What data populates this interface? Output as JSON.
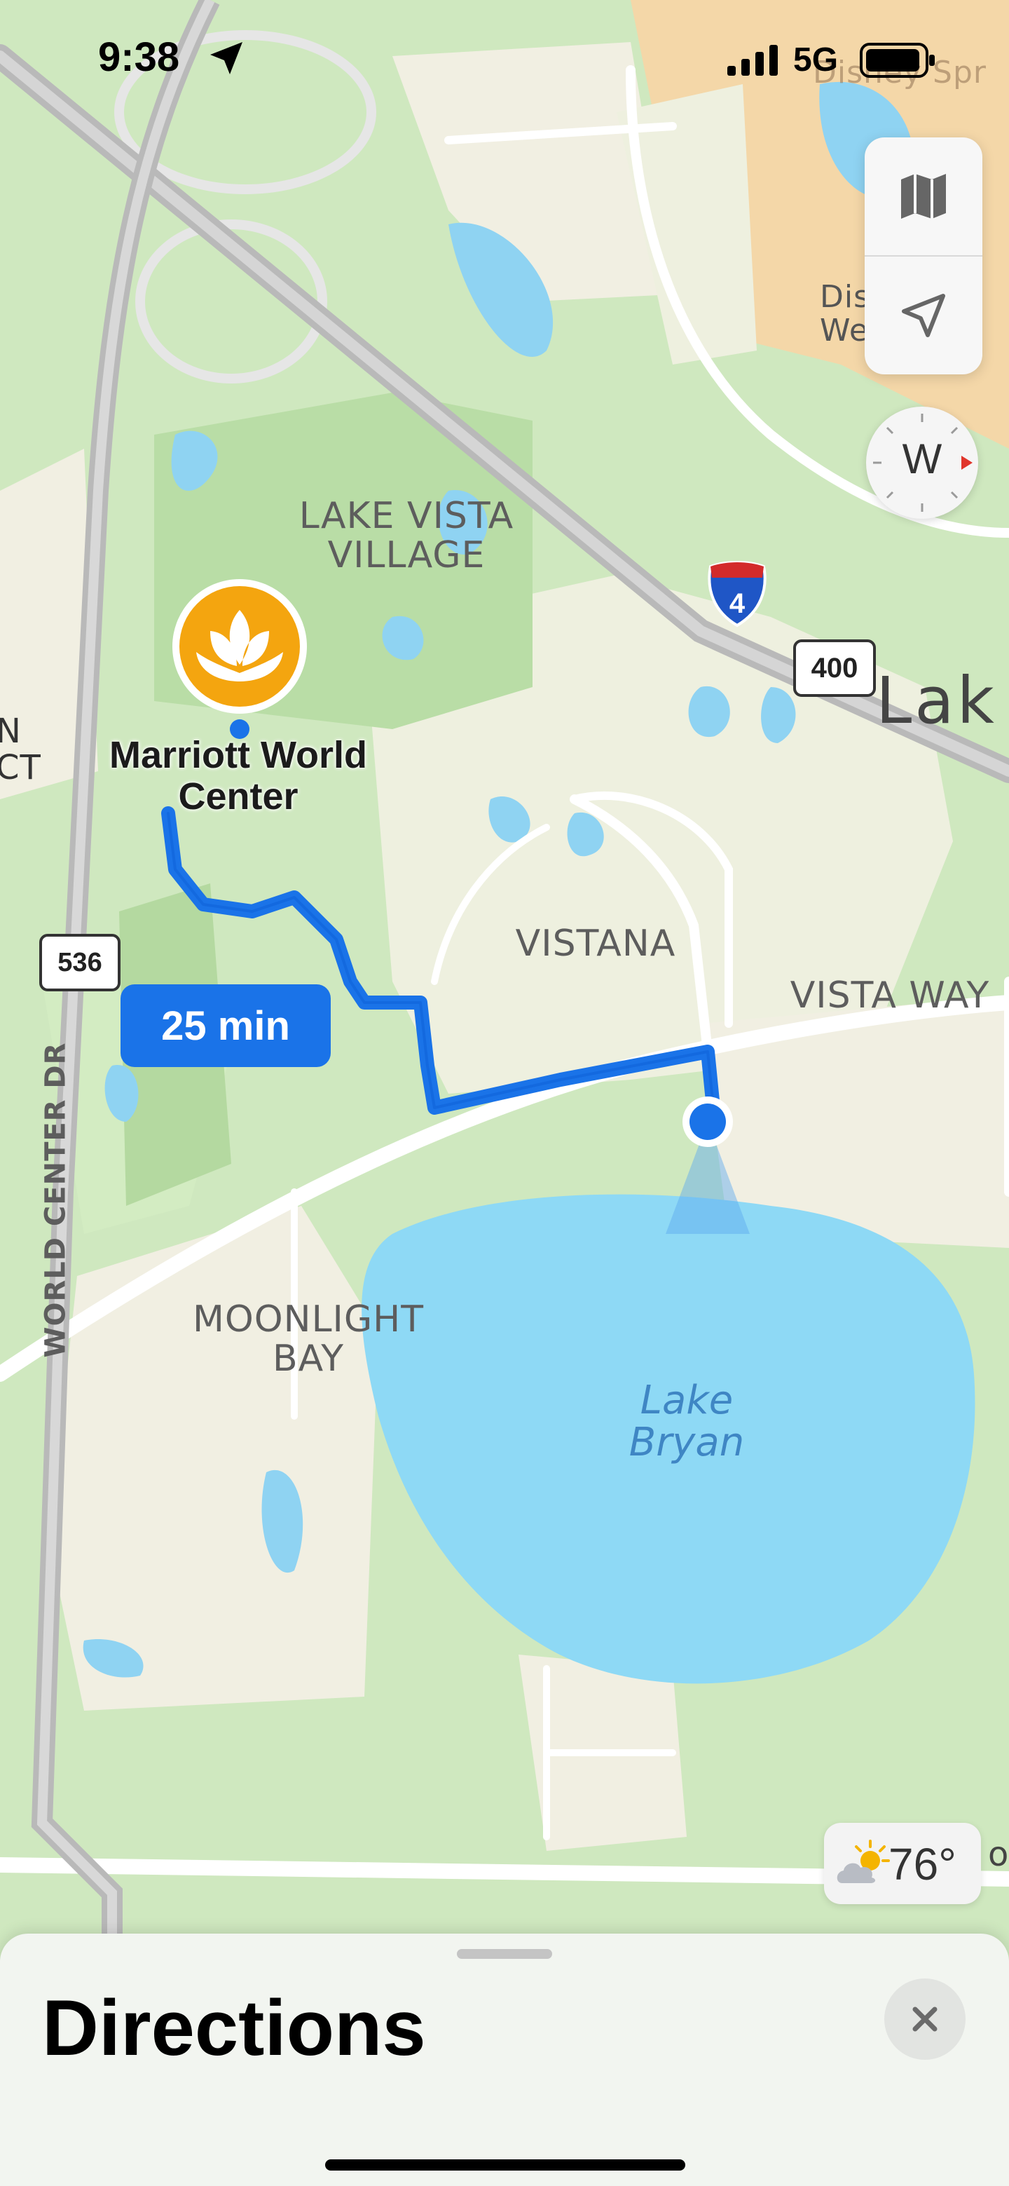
{
  "status_bar": {
    "time": "9:38",
    "network": "5G"
  },
  "map": {
    "labels": {
      "lake_vista_village": "LAKE VISTA\nVILLAGE",
      "vistana": "VISTANA",
      "vista_way": "VISTA WAY",
      "moonlight_bay": "MOONLIGHT\nBAY",
      "lake_bryan": "Lake\nBryan",
      "world_center_dr": "WORLD CENTER DR",
      "lake_partial": "Lak",
      "disney_partial": "Disney Spr",
      "dis_partial": "Dis We",
      "edge_partial": "N CT",
      "edge_partial_right": "o"
    },
    "shields": {
      "interstate": "4",
      "state_400": "400",
      "state_536": "536"
    },
    "destination": {
      "name": "Marriott World Center"
    },
    "route": {
      "eta": "25 min",
      "color": "#1a73e8"
    }
  },
  "controls": {
    "compass_heading": "W"
  },
  "weather": {
    "temperature": "76°"
  },
  "sheet": {
    "title": "Directions"
  }
}
